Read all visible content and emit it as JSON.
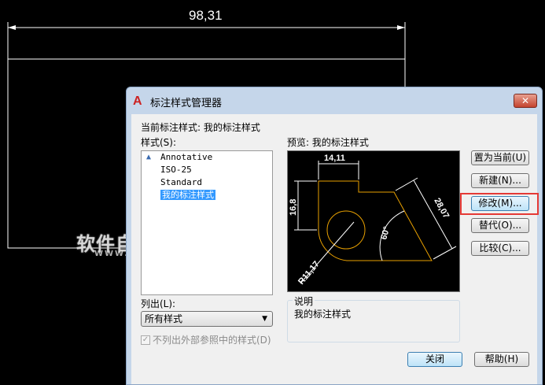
{
  "drawing": {
    "dimension": "98,31"
  },
  "dialog": {
    "title": "标注样式管理器",
    "app_icon": "A",
    "close_icon": "✕",
    "current_style_label": "当前标注样式: 我的标注样式",
    "styles_label": "样式(S):",
    "styles": [
      {
        "name": "Annotative",
        "annotative": true
      },
      {
        "name": "ISO-25"
      },
      {
        "name": "Standard"
      },
      {
        "name": "我的标注样式",
        "selected": true
      }
    ],
    "preview_label": "预览: 我的标注样式",
    "preview_dims": {
      "top": "14,11",
      "left": "16,8",
      "right": "28,07",
      "angle": "60°",
      "radius": "R11,17"
    },
    "list_label": "列出(L):",
    "list_value": "所有样式",
    "exclude_xref_label": "不列出外部参照中的样式(D)",
    "exclude_xref_checked": true,
    "description_legend": "说明",
    "description_text": "我的标注样式",
    "buttons": {
      "set_current": "置为当前(U)",
      "new": "新建(N)...",
      "modify": "修改(M)...",
      "override": "替代(O)...",
      "compare": "比较(C)...",
      "close": "关闭",
      "help": "帮助(H)"
    }
  },
  "watermark": {
    "title": "软件自学网",
    "url": "WWW.RJZXW.COM"
  }
}
